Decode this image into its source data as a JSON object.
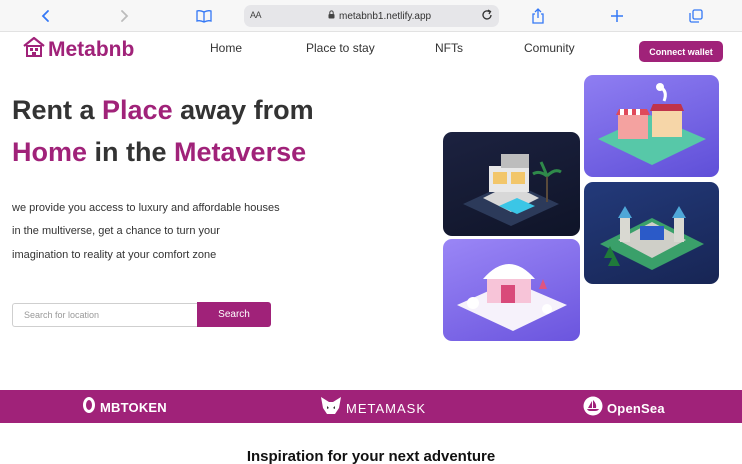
{
  "browser": {
    "text_size_label": "AA",
    "url": "metabnb1.netlify.app"
  },
  "nav": {
    "logo_text": "Metabnb",
    "links": [
      "Home",
      "Place to stay",
      "NFTs",
      "Comunity"
    ],
    "connect_label": "Connect wallet"
  },
  "hero": {
    "line1_a": "Rent a ",
    "line1_b": "Place",
    "line1_c": " away from",
    "line2_a": "Home",
    "line2_b": " in the ",
    "line2_c": "Metaverse",
    "desc": [
      "we provide you access to luxury and affordable houses",
      "in the multiverse, get a chance to turn your",
      "imagination to reality at your comfort zone"
    ],
    "search_placeholder": "Search for location",
    "search_button": "Search"
  },
  "partners": [
    "MBTOKEN",
    "METAMASK",
    "OpenSea"
  ],
  "section_title": "Inspiration for your next adventure",
  "colors": {
    "brand": "#a02279",
    "safari_accent": "#3478f6"
  }
}
